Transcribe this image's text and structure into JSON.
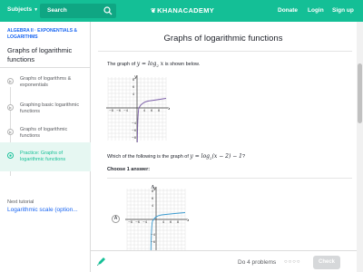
{
  "topbar": {
    "subjects_label": "Subjects",
    "subjects_icon": "chevron-down-icon",
    "search_placeholder": "Search",
    "search_icon": "magnifier-icon",
    "logo_text": "KHANACADEMY",
    "links": [
      "Donate",
      "Login",
      "Sign up"
    ],
    "bg_color": "#14bf96"
  },
  "sidebar": {
    "breadcrumb": "ALGEBRA II · EXPONENTIALS & LOGARITHMS",
    "title": "Graphs of logarithmic functions",
    "items": [
      {
        "label": "Graphs of logarithms & exponentials",
        "icon": "play-icon",
        "active": false
      },
      {
        "label": "Graphing basic logarithmic functions",
        "icon": "play-icon",
        "active": false
      },
      {
        "label": "Graphs of logarithmic functions",
        "icon": "play-icon",
        "active": false
      },
      {
        "label": "Practice: Graphs of logarithmic functions",
        "icon": "practice-icon",
        "active": true
      }
    ],
    "next_caption": "Next tutorial",
    "next_link": "Logarithmic scale (option..."
  },
  "main": {
    "title": "Graphs of logarithmic functions",
    "statement_before": "The graph of ",
    "statement_math": "y = log",
    "statement_base": "2",
    "statement_math_end": " x",
    "statement_after": " is shown below.",
    "question_before": "Which of the following is the graph of ",
    "question_math": "y = log",
    "question_base": "2",
    "question_math_end": "(x − 2) − 1",
    "question_after": "?",
    "choose_label": "Choose 1 answer:",
    "choice_letter": "A",
    "choice_radio": "A",
    "graph": {
      "x_label": "x",
      "y_label": "y",
      "x_ticks": [
        "−8",
        "−6",
        "−4",
        "4",
        "6",
        "8"
      ],
      "y_ticks_pos": [
        "8",
        "6",
        "4"
      ],
      "y_ticks_neg": [
        "−4",
        "−6",
        "−8"
      ],
      "curve_color": "#7b5ea7",
      "answer_curve_color": "#3b9bd0"
    }
  },
  "footer": {
    "hint_icon": "pencil-hint-icon",
    "progress_text": "Do 4 problems",
    "dots": "○○○○",
    "check_label": "Check"
  }
}
